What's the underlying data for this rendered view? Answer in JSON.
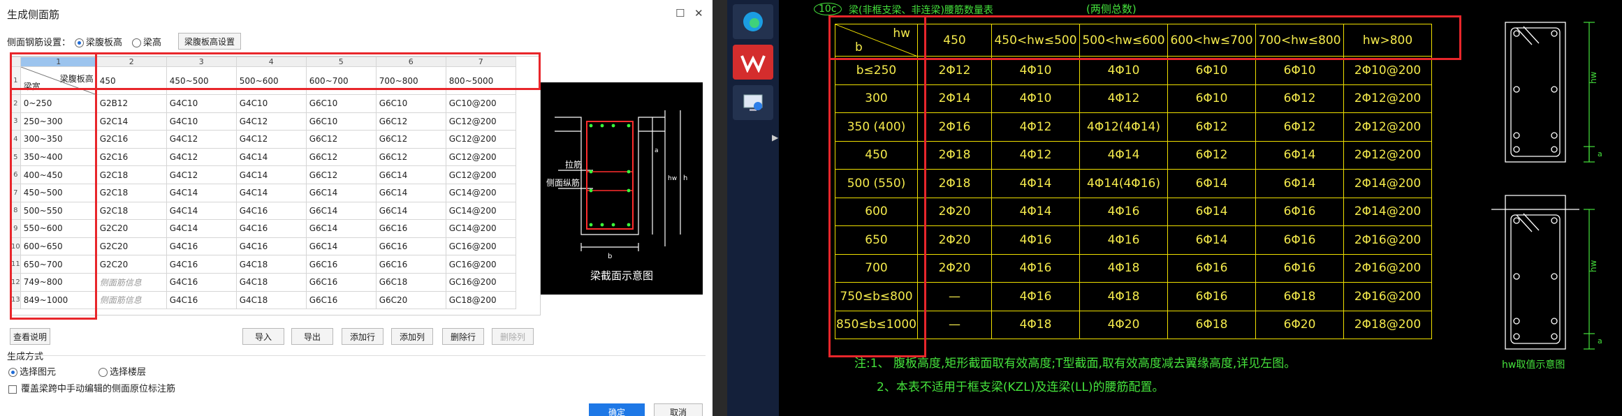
{
  "dialog": {
    "title": "生成侧面筋",
    "controls": {
      "maximize": "☐",
      "close": "✕"
    },
    "side_setting_label": "侧面钢筋设置：",
    "radio_web": "梁腹板高",
    "radio_height": "梁高",
    "web_height_setting_button": "梁腹板高设置",
    "col_numbers": [
      "1",
      "2",
      "3",
      "4",
      "5",
      "6",
      "7"
    ],
    "row_numbers": [
      "1",
      "2",
      "3",
      "4",
      "5",
      "6",
      "7",
      "8",
      "9",
      "10",
      "11",
      "12",
      "13"
    ],
    "diag_top": "梁腹板高",
    "diag_bottom": "梁宽",
    "header_cols": [
      "450",
      "450~500",
      "500~600",
      "600~700",
      "700~800",
      "800~5000"
    ],
    "rows": [
      {
        "width": "0~250",
        "cells": [
          "G2B12",
          "G4C10",
          "G4C10",
          "G6C10",
          "G6C10",
          "GC10@200"
        ]
      },
      {
        "width": "250~300",
        "cells": [
          "G2C14",
          "G4C10",
          "G4C12",
          "G6C10",
          "G6C12",
          "GC12@200"
        ]
      },
      {
        "width": "300~350",
        "cells": [
          "G2C16",
          "G4C12",
          "G4C12",
          "G6C12",
          "G6C12",
          "GC12@200"
        ]
      },
      {
        "width": "350~400",
        "cells": [
          "G2C16",
          "G4C12",
          "G4C14",
          "G6C12",
          "G6C12",
          "GC12@200"
        ]
      },
      {
        "width": "400~450",
        "cells": [
          "G2C18",
          "G4C12",
          "G4C14",
          "G6C12",
          "G6C14",
          "GC12@200"
        ]
      },
      {
        "width": "450~500",
        "cells": [
          "G2C18",
          "G4C14",
          "G4C14",
          "G6C14",
          "G6C14",
          "GC14@200"
        ]
      },
      {
        "width": "500~550",
        "cells": [
          "G2C18",
          "G4C14",
          "G4C16",
          "G6C14",
          "G6C14",
          "GC14@200"
        ]
      },
      {
        "width": "550~600",
        "cells": [
          "G2C20",
          "G4C14",
          "G4C16",
          "G6C14",
          "G6C16",
          "GC14@200"
        ]
      },
      {
        "width": "600~650",
        "cells": [
          "G2C20",
          "G4C16",
          "G4C16",
          "G6C14",
          "G6C16",
          "GC16@200"
        ]
      },
      {
        "width": "650~700",
        "cells": [
          "G2C20",
          "G4C16",
          "G4C18",
          "G6C16",
          "G6C16",
          "GC16@200"
        ]
      },
      {
        "width": "749~800",
        "cells": [
          "侧面筋信息",
          "G4C16",
          "G4C18",
          "G6C16",
          "G6C18",
          "GC16@200"
        ]
      },
      {
        "width": "849~1000",
        "cells": [
          "侧面筋信息",
          "G4C16",
          "G4C18",
          "G6C16",
          "G6C20",
          "GC18@200"
        ]
      }
    ],
    "preview": {
      "tie_label": "拉筋",
      "side_bar_label": "侧面纵筋",
      "caption": "梁截面示意图",
      "b": "b",
      "hw": "hw",
      "h": "h",
      "a": "a"
    },
    "buttons": {
      "view_notes": "查看说明",
      "import": "导入",
      "export": "导出",
      "add_row": "添加行",
      "add_column": "添加列",
      "delete_row": "删除行",
      "delete_column": "删除列",
      "ok": "确定",
      "cancel": "取消"
    },
    "generate_mode_label": "生成方式",
    "mode_select_element": "选择图元",
    "mode_select_floor": "选择楼层",
    "overwrite_label": "覆盖梁跨中手动编辑的侧面原位标注筋"
  },
  "taskbar": {
    "icons": [
      "edge-browser-icon",
      "wps-office-icon",
      "remote-desktop-icon"
    ]
  },
  "cad": {
    "circle_tag": "10c",
    "title": "梁(非框支梁、非连梁)腰筋数量表",
    "subtitle": "(两侧总数)",
    "hw": "hw",
    "b": "b",
    "headers": [
      "450",
      "450<hw≤500",
      "500<hw≤600",
      "600<hw≤700",
      "700<hw≤800",
      "hw>800"
    ],
    "rows": [
      {
        "b": "b≤250",
        "cells": [
          "2Φ12",
          "4Φ10",
          "4Φ10",
          "6Φ10",
          "6Φ10",
          "2Φ10@200"
        ]
      },
      {
        "b": "300",
        "cells": [
          "2Φ14",
          "4Φ10",
          "4Φ12",
          "6Φ10",
          "6Φ12",
          "2Φ12@200"
        ]
      },
      {
        "b": "350 (400)",
        "cells": [
          "2Φ16",
          "4Φ12",
          "4Φ12(4Φ14)",
          "6Φ12",
          "6Φ12",
          "2Φ12@200"
        ]
      },
      {
        "b": "450",
        "cells": [
          "2Φ18",
          "4Φ12",
          "4Φ14",
          "6Φ12",
          "6Φ14",
          "2Φ12@200"
        ]
      },
      {
        "b": "500 (550)",
        "cells": [
          "2Φ18",
          "4Φ14",
          "4Φ14(4Φ16)",
          "6Φ14",
          "6Φ14",
          "2Φ14@200"
        ]
      },
      {
        "b": "600",
        "cells": [
          "2Φ20",
          "4Φ14",
          "4Φ16",
          "6Φ14",
          "6Φ16",
          "2Φ14@200"
        ]
      },
      {
        "b": "650",
        "cells": [
          "2Φ20",
          "4Φ16",
          "4Φ16",
          "6Φ14",
          "6Φ16",
          "2Φ16@200"
        ]
      },
      {
        "b": "700",
        "cells": [
          "2Φ20",
          "4Φ16",
          "4Φ18",
          "6Φ16",
          "6Φ16",
          "2Φ16@200"
        ]
      },
      {
        "b": "750≤b≤800",
        "cells": [
          "—",
          "4Φ16",
          "4Φ18",
          "6Φ16",
          "6Φ18",
          "2Φ16@200"
        ]
      },
      {
        "b": "850≤b≤1000",
        "cells": [
          "—",
          "4Φ18",
          "4Φ20",
          "6Φ18",
          "6Φ20",
          "2Φ18@200"
        ]
      }
    ],
    "note1": "注:1、 腹板高度,矩形截面取有效高度;T型截面,取有效高度减去翼缘高度,详见左图。",
    "note2": "2、本表不适用于框支梁(KZL)及连梁(LL)的腰筋配置。",
    "diagram_label": "hw取值示意图",
    "diag_hw": "hw",
    "diag_a": "a"
  },
  "colors": {
    "red_highlight": "#e8262b",
    "cad_yellow": "#f0e000",
    "cad_green": "#45e23c"
  }
}
